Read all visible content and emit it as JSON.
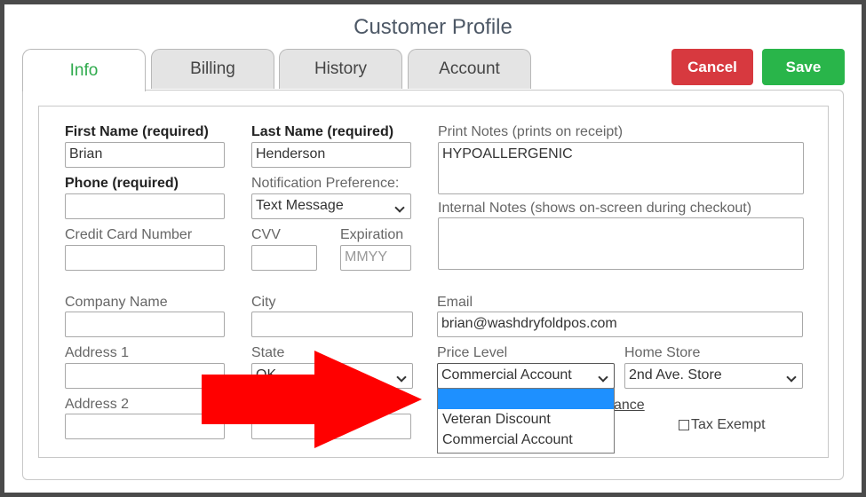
{
  "window": {
    "title": "Customer Profile"
  },
  "tabs": [
    {
      "label": "Info",
      "active": true
    },
    {
      "label": "Billing",
      "active": false
    },
    {
      "label": "History",
      "active": false
    },
    {
      "label": "Account",
      "active": false
    }
  ],
  "actions": {
    "cancel_label": "Cancel",
    "save_label": "Save",
    "cancel_color": "#d7393f",
    "save_color": "#29b54a"
  },
  "form": {
    "first_name": {
      "label": "First Name (required)",
      "value": "Brian"
    },
    "last_name": {
      "label": "Last Name (required)",
      "value": "Henderson"
    },
    "phone": {
      "label": "Phone (required)",
      "value": ""
    },
    "notification": {
      "label": "Notification Preference:",
      "value": "Text Message"
    },
    "credit_card": {
      "label": "Credit Card Number",
      "value": ""
    },
    "cvv": {
      "label": "CVV",
      "value": ""
    },
    "expiration": {
      "label": "Expiration",
      "placeholder": "MMYY"
    },
    "print_notes": {
      "label": "Print Notes (prints on receipt)",
      "value": "HYPOALLERGENIC"
    },
    "internal_notes": {
      "label": "Internal Notes (shows on-screen during checkout)",
      "value": ""
    },
    "company": {
      "label": "Company Name",
      "value": ""
    },
    "city": {
      "label": "City",
      "value": ""
    },
    "email": {
      "label": "Email",
      "value": "brian@washdryfoldpos.com"
    },
    "address1": {
      "label": "Address 1",
      "value": ""
    },
    "state": {
      "label": "State",
      "value": "OK"
    },
    "price_level": {
      "label": "Price Level",
      "value": "Commercial Account"
    },
    "home_store": {
      "label": "Home Store",
      "value": "2nd Ave. Store"
    },
    "address2": {
      "label": "Address 2",
      "value": ""
    },
    "balance_link": "ance",
    "tax_exempt": {
      "label": "Tax Exempt",
      "checked": false
    }
  },
  "price_level_options": [
    "",
    "Veteran Discount",
    "Commercial Account"
  ],
  "annotation": {
    "arrow_color": "#ff0000",
    "icon": "right-arrow-icon"
  }
}
